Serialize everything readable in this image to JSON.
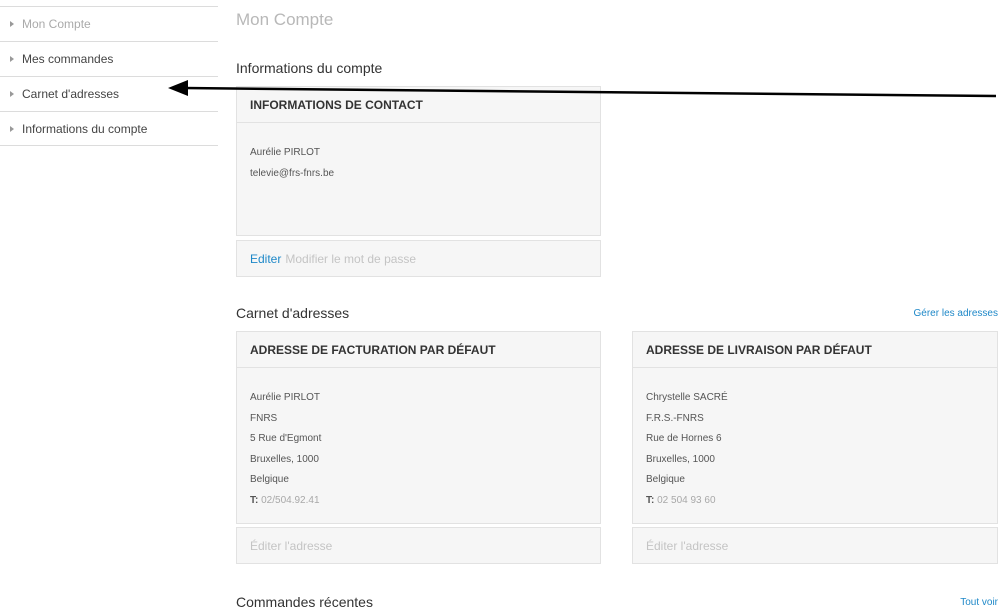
{
  "sidebar": {
    "items": [
      {
        "label": "Mon Compte"
      },
      {
        "label": "Mes commandes"
      },
      {
        "label": "Carnet d'adresses"
      },
      {
        "label": "Informations du compte"
      }
    ]
  },
  "page": {
    "title": "Mon Compte"
  },
  "account_info": {
    "section_title": "Informations du compte",
    "contact_card": {
      "title": "INFORMATIONS DE CONTACT",
      "name": "Aurélie PIRLOT",
      "email": "televie@frs-fnrs.be",
      "edit_label": "Editer",
      "change_password_label": "Modifier le mot de passe"
    }
  },
  "address_book": {
    "section_title": "Carnet d'adresses",
    "manage_link": "Gérer les adresses",
    "billing": {
      "title": "ADRESSE DE FACTURATION PAR DÉFAUT",
      "lines": [
        "Aurélie PIRLOT",
        "FNRS",
        "5 Rue d'Egmont",
        "Bruxelles, 1000",
        "Belgique"
      ],
      "phone_label": "T:",
      "phone": "02/504.92.41",
      "edit_label": "Éditer l'adresse"
    },
    "shipping": {
      "title": "ADRESSE DE LIVRAISON PAR DÉFAUT",
      "lines": [
        "Chrystelle SACRÉ",
        "F.R.S.-FNRS",
        "Rue de Hornes 6",
        "Bruxelles, 1000",
        "Belgique"
      ],
      "phone_label": "T:",
      "phone": "02 504 93 60",
      "edit_label": "Éditer l'adresse"
    }
  },
  "recent_orders": {
    "section_title": "Commandes récentes",
    "view_all_link": "Tout voir"
  }
}
